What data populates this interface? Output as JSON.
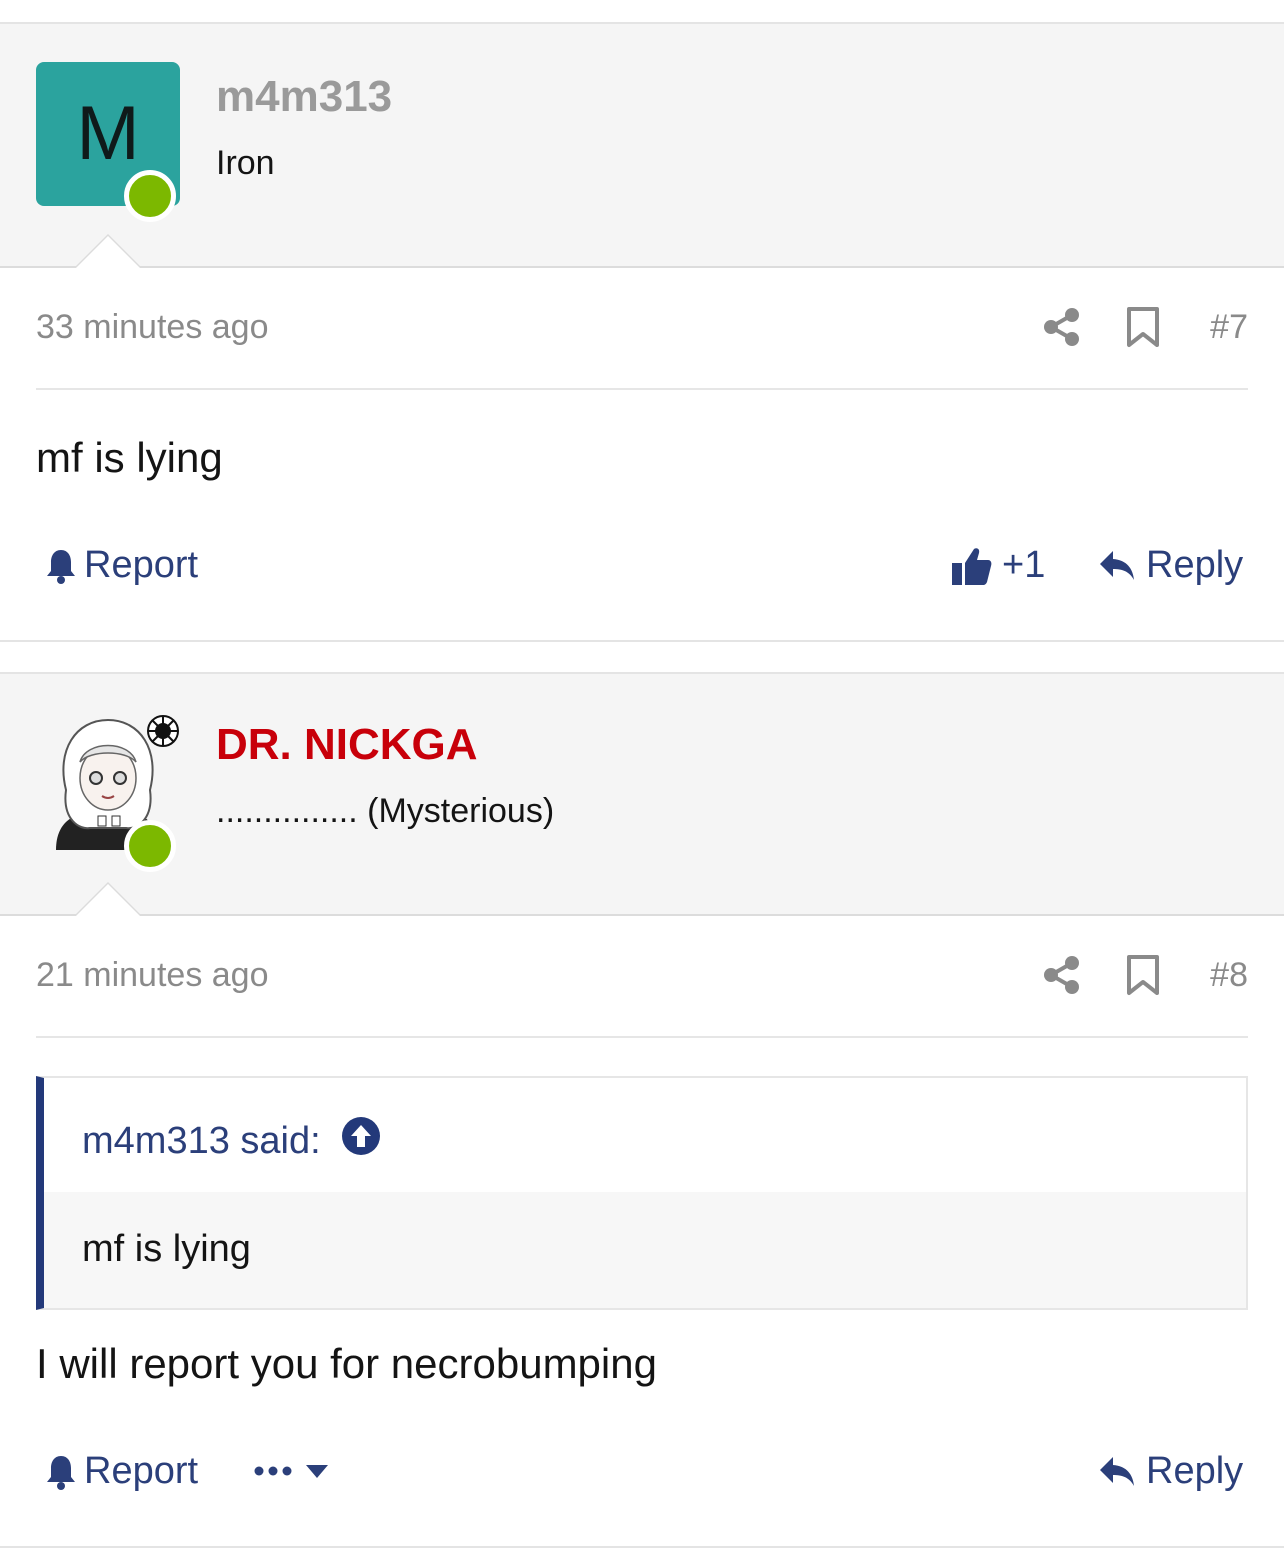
{
  "posts": [
    {
      "author": "m4m313",
      "author_color": "#9a9a9a",
      "avatar_letter": "M",
      "avatar_color": "#2ba39e",
      "user_title": "Iron",
      "time": "33 minutes ago",
      "post_number": "#7",
      "message": "mf is lying",
      "report_label": "Report",
      "like_count": "+1",
      "reply_label": "Reply"
    },
    {
      "author": "DR. NICKGA",
      "author_color": "#c8000a",
      "user_title": "............... (Mysterious)",
      "time": "21 minutes ago",
      "post_number": "#8",
      "quote": {
        "header": "m4m313 said:",
        "text": "mf is lying"
      },
      "message": "I will report you for necrobumping",
      "report_label": "Report",
      "reply_label": "Reply"
    }
  ],
  "colors": {
    "link": "#2b3f7a",
    "online": "#7cb800",
    "meta": "#8a8a8a"
  },
  "icons": {
    "share": "share-icon",
    "bookmark": "bookmark-icon",
    "bell": "bell-icon",
    "thumbs_up": "thumbs-up-icon",
    "reply": "reply-icon",
    "more": "more-dots-icon",
    "caret": "caret-down-icon",
    "jump": "arrow-up-circle-icon"
  }
}
